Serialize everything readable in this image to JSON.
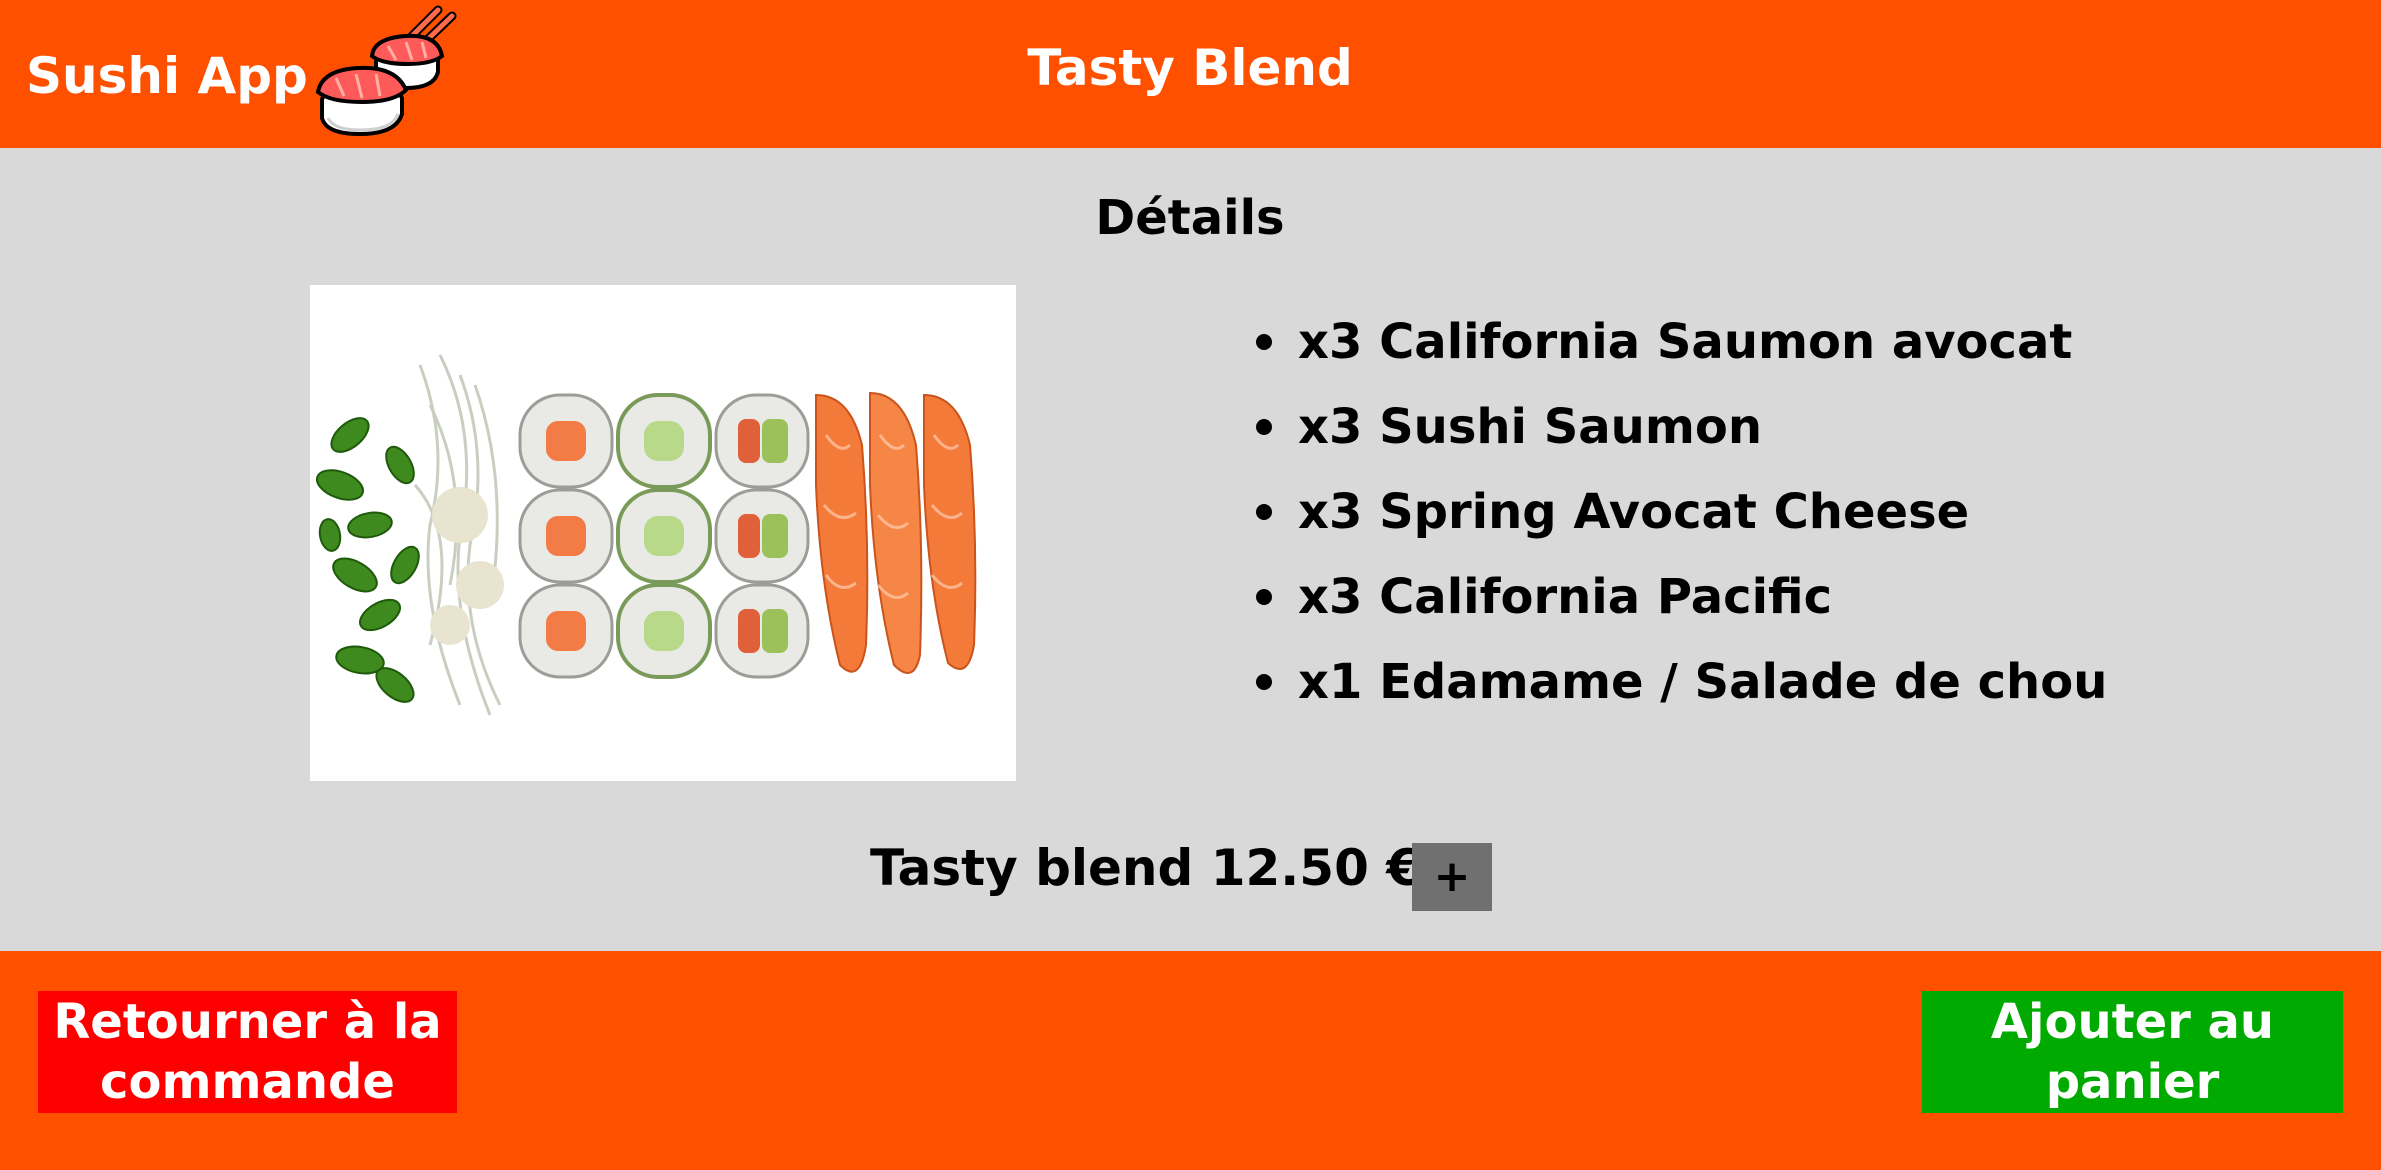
{
  "header": {
    "app_title": "Sushi App",
    "logo_icon": "sushi-chopsticks-icon",
    "page_title": "Tasty Blend"
  },
  "details": {
    "heading": "Détails",
    "image": "sushi-platter-image",
    "items": [
      "x3 California Saumon avocat",
      "x3 Sushi Saumon",
      "x3 Spring Avocat Cheese",
      "x3 California Pacific",
      "x1 Edamame / Salade de chou"
    ],
    "price_line": "Tasty blend 12.50 €",
    "add_button_label": "+"
  },
  "footer": {
    "back_label": "Retourner à la commande",
    "add_to_cart_label": "Ajouter au panier"
  },
  "colors": {
    "brand_orange": "#ff5000",
    "background_gray": "#d9d9d9",
    "back_button_red": "#ff0000",
    "cart_button_green": "#00aa00",
    "plus_button_gray": "#707070"
  }
}
